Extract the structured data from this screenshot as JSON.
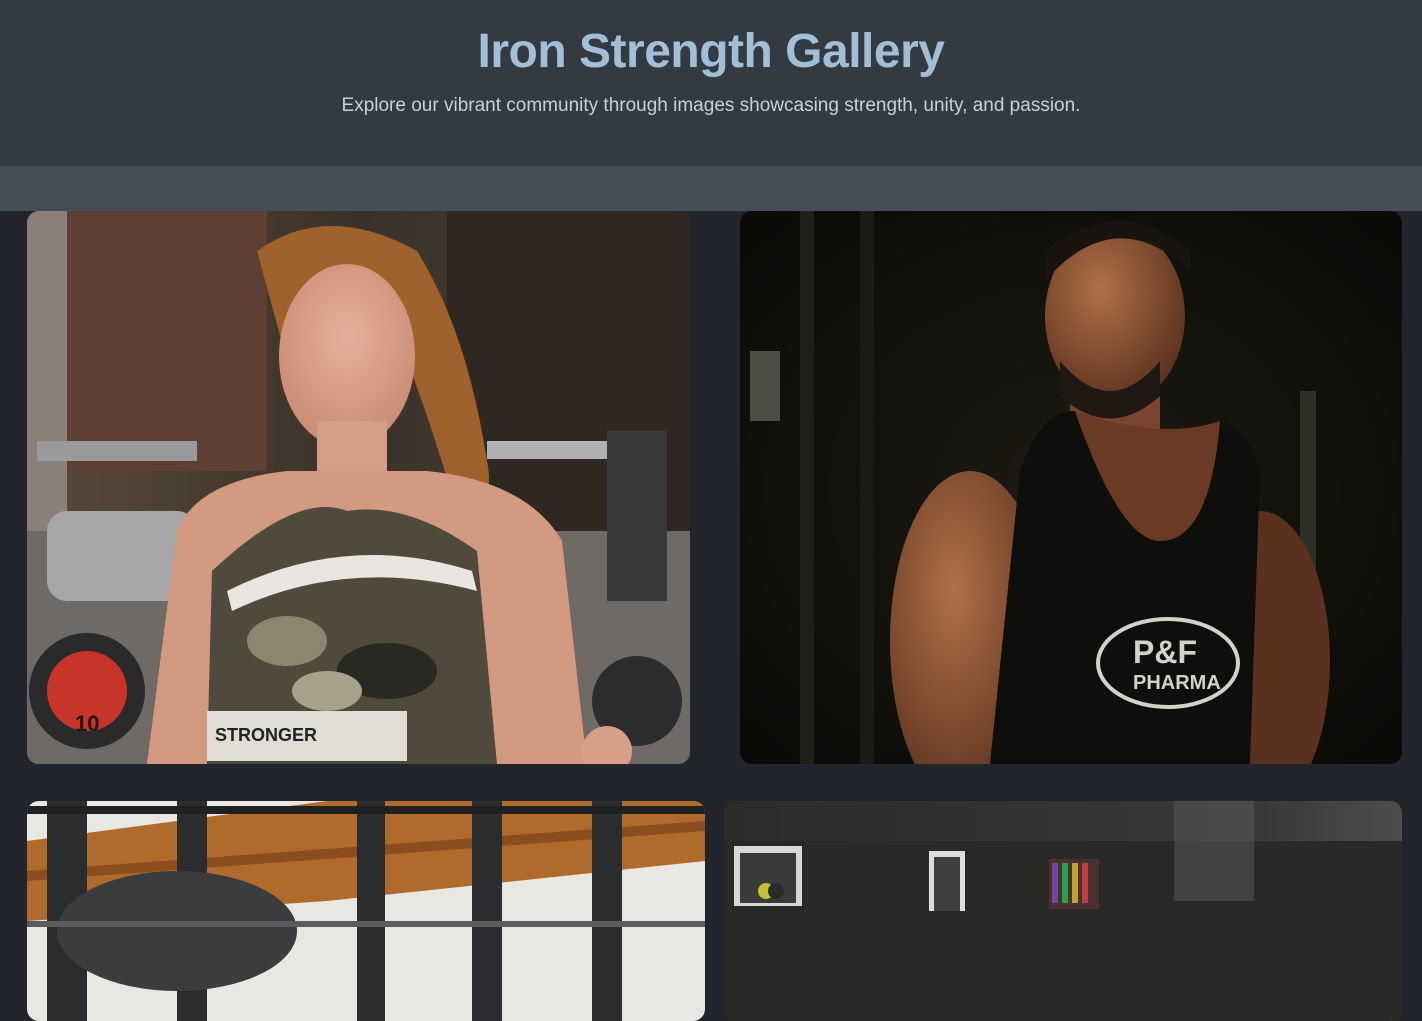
{
  "header": {
    "title": "Iron Strength Gallery",
    "subtitle": "Explore our vibrant community through images showcasing strength, unity, and passion."
  },
  "gallery": {
    "photos": [
      {
        "description": "photo-woman-dumbbell-curl",
        "shirt_text": "STRONGER",
        "plate_text": "10"
      },
      {
        "description": "photo-man-black-tank",
        "logo_text_1": "P&F",
        "logo_text_2": "PHARMA"
      },
      {
        "description": "photo-squat-rack"
      },
      {
        "description": "photo-gym-interior"
      }
    ]
  },
  "colors": {
    "page_bg": "#22262c",
    "header_bg": "#343a42",
    "band_bg": "#454d58",
    "title": "#a3bfd8",
    "subtitle": "#c9d0d8"
  }
}
